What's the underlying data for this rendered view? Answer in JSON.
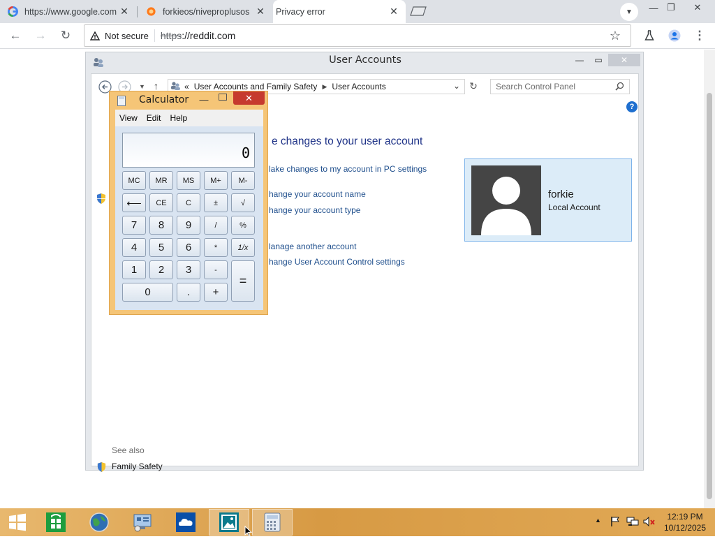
{
  "browser": {
    "tabs": [
      {
        "title": "https://www.google.com",
        "active": false
      },
      {
        "title": "forkieos/niveproplusos",
        "active": false
      },
      {
        "title": "Privacy error",
        "active": true
      }
    ],
    "security_label": "Not secure",
    "url_scheme": "https",
    "url_rest": "://reddit.com"
  },
  "user_accounts": {
    "window_title": "User Accounts",
    "breadcrumb": [
      "«",
      "User Accounts and Family Safety",
      "User Accounts"
    ],
    "search_placeholder": "Search Control Panel",
    "heading": "e changes to your user account",
    "links": [
      "lake changes to my account in PC settings",
      "hange your account name",
      "hange your account type",
      "lanage another account",
      "hange User Account Control settings"
    ],
    "account": {
      "name": "forkie",
      "type": "Local Account"
    },
    "see_also_label": "See also",
    "see_also_items": [
      "Family Safety"
    ]
  },
  "calculator": {
    "title": "Calculator",
    "menu": [
      "View",
      "Edit",
      "Help"
    ],
    "display": "0",
    "keys": {
      "row1": [
        "MC",
        "MR",
        "MS",
        "M+",
        "M-"
      ],
      "row2": [
        "⟵",
        "CE",
        "C",
        "±",
        "√"
      ],
      "row3": [
        "7",
        "8",
        "9",
        "/",
        "%"
      ],
      "row4": [
        "4",
        "5",
        "6",
        "*",
        "1/x"
      ],
      "row5": [
        "1",
        "2",
        "3",
        "-"
      ],
      "equals": "=",
      "zero": "0",
      "dot": ".",
      "plus": "+"
    }
  },
  "taskbar": {
    "clock_time": "12:19 PM",
    "clock_date": "10/12/2025"
  }
}
